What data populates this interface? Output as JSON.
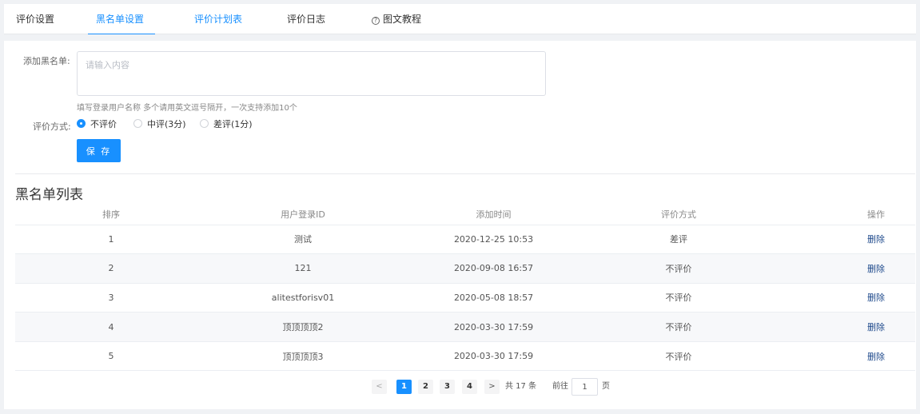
{
  "tabs": [
    {
      "label": "评价设置"
    },
    {
      "label": "黑名单设置"
    },
    {
      "label": "评价计划表"
    },
    {
      "label": "评价日志"
    },
    {
      "label": "图文教程",
      "icon": "question-circle-icon"
    }
  ],
  "form": {
    "add_label": "添加黑名单:",
    "textarea_placeholder": "请输入内容",
    "hint": "填写登录用户名称 多个请用英文逗号隔开，一次支持添加10个",
    "method_label": "评价方式:",
    "options": [
      {
        "label": "不评价",
        "checked": true
      },
      {
        "label": "中评(3分)",
        "checked": false
      },
      {
        "label": "差评(1分)",
        "checked": false
      }
    ],
    "save_label": "保 存"
  },
  "list": {
    "title": "黑名单列表",
    "headers": [
      "排序",
      "用户登录ID",
      "添加时间",
      "评价方式",
      "操作"
    ],
    "rows": [
      {
        "no": "1",
        "user": "测试",
        "time": "2020-12-25 10:53",
        "method": "差评",
        "action": "删除"
      },
      {
        "no": "2",
        "user": "121",
        "time": "2020-09-08 16:57",
        "method": "不评价",
        "action": "删除"
      },
      {
        "no": "3",
        "user": "alitestforisv01",
        "time": "2020-05-08 18:57",
        "method": "不评价",
        "action": "删除"
      },
      {
        "no": "4",
        "user": "顶顶顶顶2",
        "time": "2020-03-30 17:59",
        "method": "不评价",
        "action": "删除"
      },
      {
        "no": "5",
        "user": "顶顶顶顶3",
        "time": "2020-03-30 17:59",
        "method": "不评价",
        "action": "删除"
      }
    ]
  },
  "pagination": {
    "pages": [
      "1",
      "2",
      "3",
      "4"
    ],
    "current": "1",
    "prev": "<",
    "next": ">",
    "total": "共 17 条",
    "goto_prefix": "前往",
    "goto_value": "1",
    "goto_suffix": "页"
  },
  "colors": {
    "accent": "#1890ff",
    "link": "#1f4a8c"
  }
}
